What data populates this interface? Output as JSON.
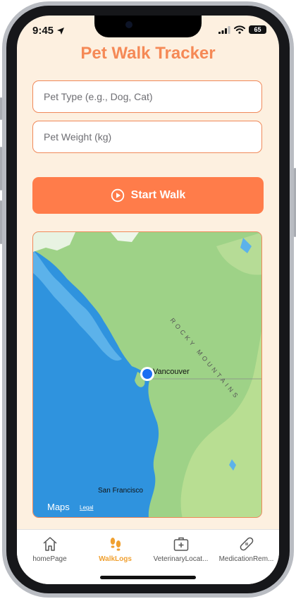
{
  "status_bar": {
    "time": "9:45",
    "battery": "65"
  },
  "app": {
    "title": "Pet Walk Tracker"
  },
  "form": {
    "pet_type": {
      "value": "",
      "placeholder": "Pet Type (e.g., Dog, Cat)"
    },
    "pet_weight": {
      "value": "",
      "placeholder": "Pet Weight (kg)"
    }
  },
  "start_button": {
    "label": "Start Walk",
    "icon": "play-circle-icon"
  },
  "map": {
    "city_current": "Vancouver",
    "city_south": "San Francisco",
    "mountain_label": "ROCKY MOUNTAINS",
    "provider": "Maps",
    "legal": "Legal"
  },
  "tabs": [
    {
      "label": "homePage",
      "icon": "house-icon",
      "active": false
    },
    {
      "label": "WalkLogs",
      "icon": "footprints-icon",
      "active": true
    },
    {
      "label": "VeterinaryLocat...",
      "icon": "medical-bag-icon",
      "active": false
    },
    {
      "label": "MedicationRem...",
      "icon": "bandage-icon",
      "active": false
    }
  ],
  "colors": {
    "accent": "#ff7c4a",
    "active_tab": "#f0a030",
    "background": "#fdf0e0"
  }
}
